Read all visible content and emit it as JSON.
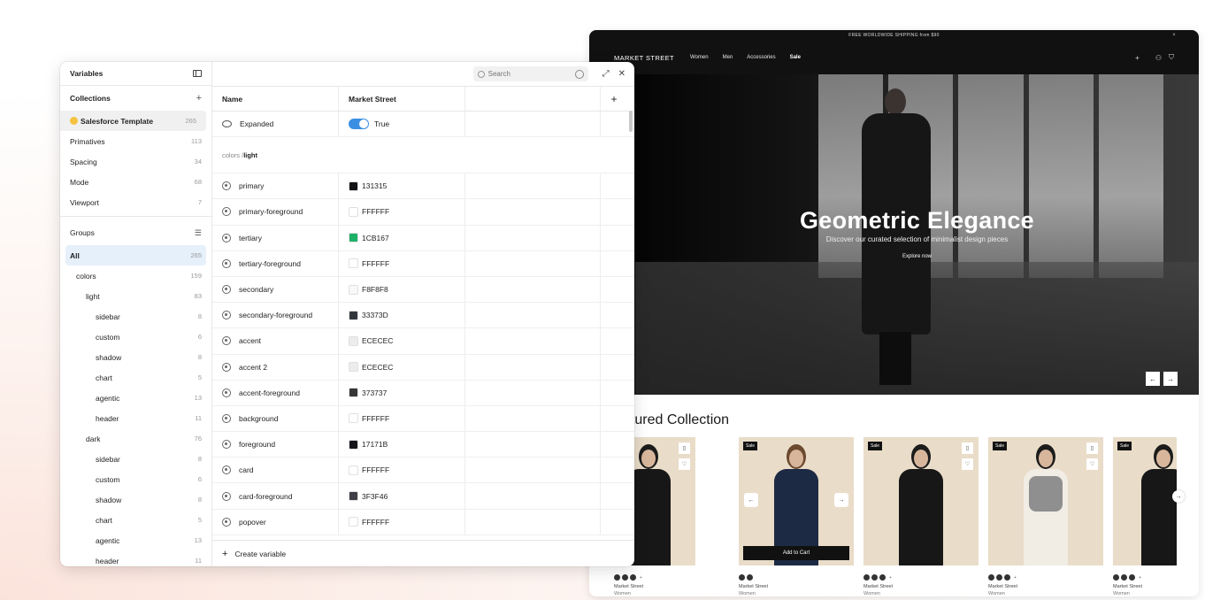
{
  "website": {
    "shipping_banner": "FREE WORLDWIDE SHIPPING from $90",
    "close_symbol": "×",
    "brand": "MARKET STREET",
    "nav_links": [
      "Women",
      "Men",
      "Accessories",
      "Sale"
    ],
    "icons": [
      "plus-icon",
      "user-icon",
      "cart-icon"
    ],
    "hero": {
      "title": "Geometric Elegance",
      "subtitle": "Discover our curated selection of minimalist design pieces",
      "cta": "Explore now",
      "prev": "←",
      "next": "→"
    },
    "featured_title": "atured Collection",
    "products": [
      {
        "name": "Market Street",
        "category": "Women",
        "badge": ""
      },
      {
        "name": "Market Street",
        "category": "Women",
        "badge": "Sale",
        "action": "Add to Cart"
      },
      {
        "name": "Market Street",
        "category": "Women",
        "badge": "Sale"
      },
      {
        "name": "Market Street",
        "category": "Women",
        "badge": "Sale"
      },
      {
        "name": "Market Street",
        "category": "Women",
        "badge": "Sale"
      }
    ],
    "swatch_more": "+"
  },
  "variables_panel": {
    "title": "Variables",
    "collections_label": "Collections",
    "collections": [
      {
        "name": "Salesforce Template",
        "count": "265"
      },
      {
        "name": "Primatives",
        "count": "113"
      },
      {
        "name": "Spacing",
        "count": "34"
      },
      {
        "name": "Mode",
        "count": "68"
      },
      {
        "name": "Viewport",
        "count": "7"
      }
    ],
    "groups_label": "Groups",
    "groups": [
      {
        "name": "All",
        "count": "265"
      },
      {
        "name": "colors",
        "count": "159"
      },
      {
        "name": "light",
        "count": "83"
      },
      {
        "name": "sidebar",
        "count": "8"
      },
      {
        "name": "custom",
        "count": "6"
      },
      {
        "name": "shadow",
        "count": "8"
      },
      {
        "name": "chart",
        "count": "5"
      },
      {
        "name": "agentic",
        "count": "13"
      },
      {
        "name": "header",
        "count": "11"
      },
      {
        "name": "dark",
        "count": "76"
      },
      {
        "name": "sidebar",
        "count": "8"
      },
      {
        "name": "custom",
        "count": "6"
      },
      {
        "name": "shadow",
        "count": "8"
      },
      {
        "name": "chart",
        "count": "5"
      },
      {
        "name": "agentic",
        "count": "13"
      },
      {
        "name": "header",
        "count": "11"
      }
    ],
    "search_placeholder": "Search",
    "columns": {
      "name": "Name",
      "mode": "Market Street",
      "add": "+"
    },
    "expanded": {
      "name": "Expanded",
      "value": "True"
    },
    "group_path": {
      "parent": "colors / ",
      "current": "light"
    },
    "variables": [
      {
        "name": "primary",
        "value": "131315",
        "color": "#131315"
      },
      {
        "name": "primary-foreground",
        "value": "FFFFFF",
        "color": "#FFFFFF"
      },
      {
        "name": "tertiary",
        "value": "1CB167",
        "color": "#1CB167"
      },
      {
        "name": "tertiary-foreground",
        "value": "FFFFFF",
        "color": "#FFFFFF"
      },
      {
        "name": "secondary",
        "value": "F8F8F8",
        "color": "#F8F8F8"
      },
      {
        "name": "secondary-foreground",
        "value": "33373D",
        "color": "#33373D"
      },
      {
        "name": "accent",
        "value": "ECECEC",
        "color": "#ECECEC"
      },
      {
        "name": "accent 2",
        "value": "ECECEC",
        "color": "#ECECEC"
      },
      {
        "name": "accent-foreground",
        "value": "373737",
        "color": "#373737"
      },
      {
        "name": "background",
        "value": "FFFFFF",
        "color": "#FFFFFF"
      },
      {
        "name": "foreground",
        "value": "17171B",
        "color": "#17171B"
      },
      {
        "name": "card",
        "value": "FFFFFF",
        "color": "#FFFFFF"
      },
      {
        "name": "card-foreground",
        "value": "3F3F46",
        "color": "#3F3F46"
      },
      {
        "name": "popover",
        "value": "FFFFFF",
        "color": "#FFFFFF"
      }
    ],
    "create_variable": "Create variable"
  }
}
